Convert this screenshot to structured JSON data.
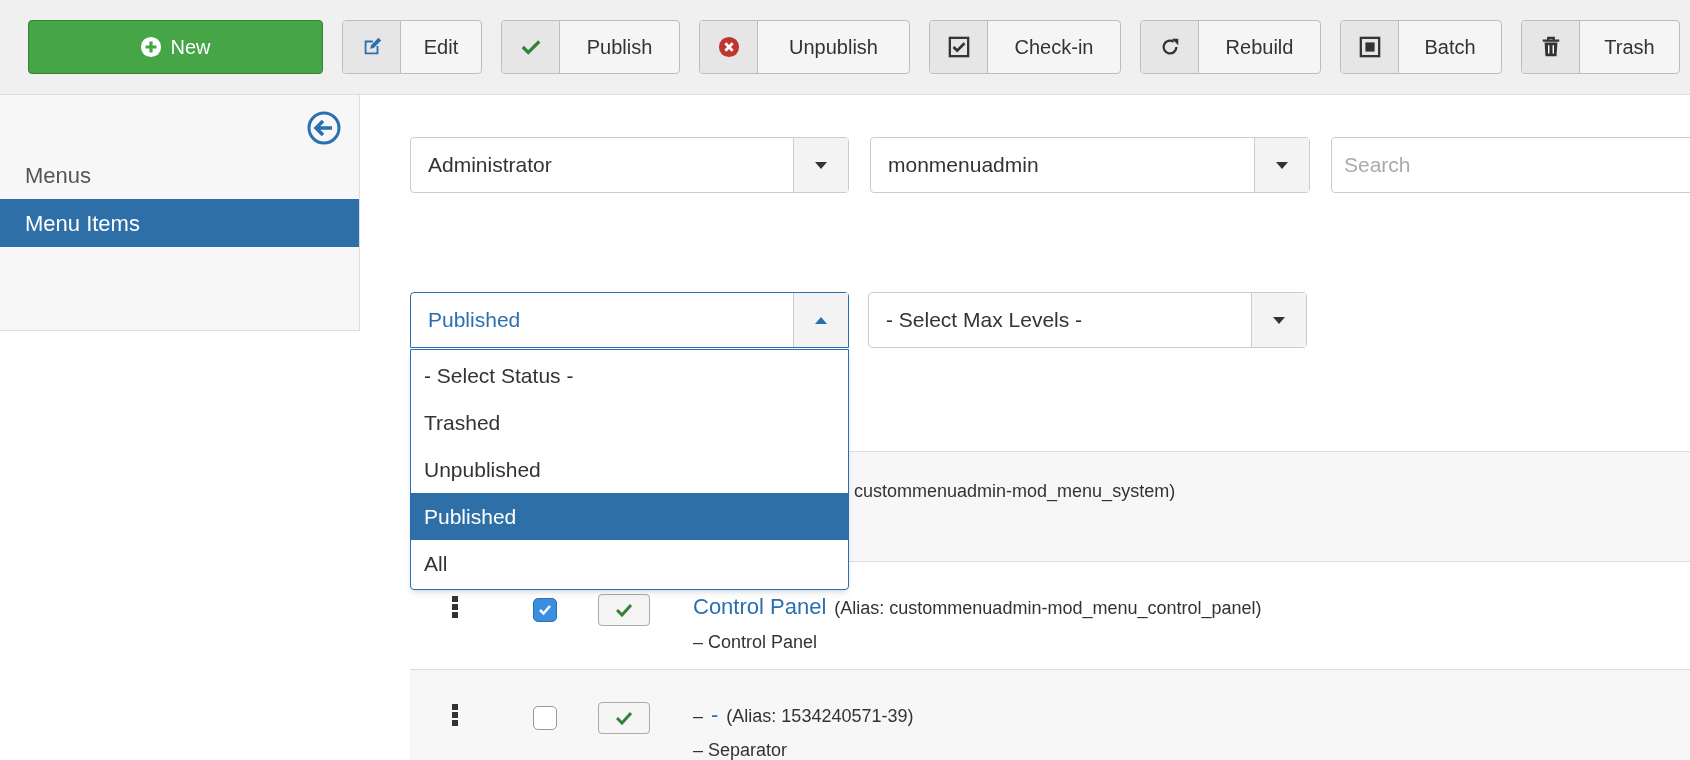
{
  "toolbar": {
    "buttons": [
      {
        "label": "New",
        "kind": "primary"
      },
      {
        "label": "Edit",
        "kind": "default"
      },
      {
        "label": "Publish",
        "kind": "default"
      },
      {
        "label": "Unpublish",
        "kind": "default"
      },
      {
        "label": "Check-in",
        "kind": "default"
      },
      {
        "label": "Rebuild",
        "kind": "default"
      },
      {
        "label": "Batch",
        "kind": "default"
      },
      {
        "label": "Trash",
        "kind": "default"
      }
    ]
  },
  "sidebar": {
    "items": [
      {
        "label": "Menus",
        "selected": false
      },
      {
        "label": "Menu Items",
        "selected": true
      }
    ]
  },
  "filters": {
    "client": {
      "value": "Administrator"
    },
    "menu": {
      "value": "monmenuadmin"
    },
    "search": {
      "placeholder": "Search"
    },
    "status": {
      "value": "Published",
      "open": true,
      "options": [
        {
          "label": "- Select Status -",
          "selected": false
        },
        {
          "label": "Trashed",
          "selected": false
        },
        {
          "label": "Unpublished",
          "selected": false
        },
        {
          "label": "Published",
          "selected": true
        },
        {
          "label": "All",
          "selected": false
        }
      ]
    },
    "levels": {
      "value": "- Select Max Levels -"
    }
  },
  "table": {
    "rows": [
      {
        "kind": "partial",
        "text": "custommenuadmin-mod_menu_system)"
      },
      {
        "kind": "item",
        "checked": true,
        "published": true,
        "prefix": "",
        "title": "Control Panel",
        "alias": "(Alias: custommenuadmin-mod_menu_control_panel)",
        "type": "– Control Panel"
      },
      {
        "kind": "item",
        "checked": false,
        "published": true,
        "prefix": "–",
        "title": "-",
        "alias": "(Alias: 1534240571-39)",
        "type": "– Separator"
      }
    ]
  }
}
